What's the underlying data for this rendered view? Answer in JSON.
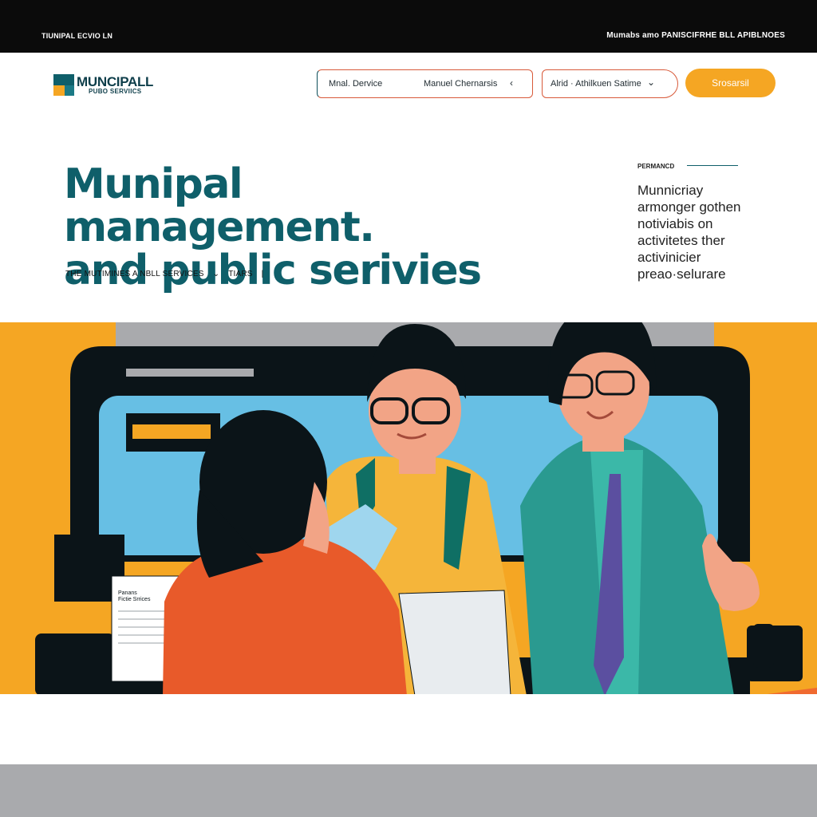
{
  "topbar": {
    "left_text": "TIUNIPAL ECVIO LN",
    "right_text": "Mumabs amo PANISCIFRHE BLL APIBLNOES"
  },
  "header": {
    "logo_title": "MUNCIPALL",
    "logo_subtitle": "PUBO SERVIICS",
    "field_service_label": "Mnal. Dervice",
    "field_service_value": "Manuel Chernarsis",
    "field_area_value": "Alrid · Athilkuen Satime",
    "search_label": "Srosarsil"
  },
  "hero": {
    "title_line1": "Munipal management.",
    "title_line2": "and public serivies",
    "sub_part1": "THE  MUTIMINES A  NBLL SERVICES",
    "sub_part2": "TIARS",
    "side_label": "PERMANCD",
    "side_lines": [
      "Munnicriay",
      "armonger gothen",
      "notiviabis on",
      "activitetes ther",
      "activinicier",
      "preao·selurare"
    ]
  },
  "illustration": {
    "document_text_line1": "Panans",
    "document_text_line2": "Fictie Srrices"
  },
  "colors": {
    "accent_teal": "#0f5f6a",
    "accent_orange": "#f5a623",
    "accent_red": "#d85a3a",
    "topbar_bg": "#0b0b0b"
  },
  "icons": {
    "field_service_icon": "chevron-left-icon",
    "field_area_icon": "chevron-down-icon",
    "sub_dropdown_icon": "chevron-down-icon"
  }
}
